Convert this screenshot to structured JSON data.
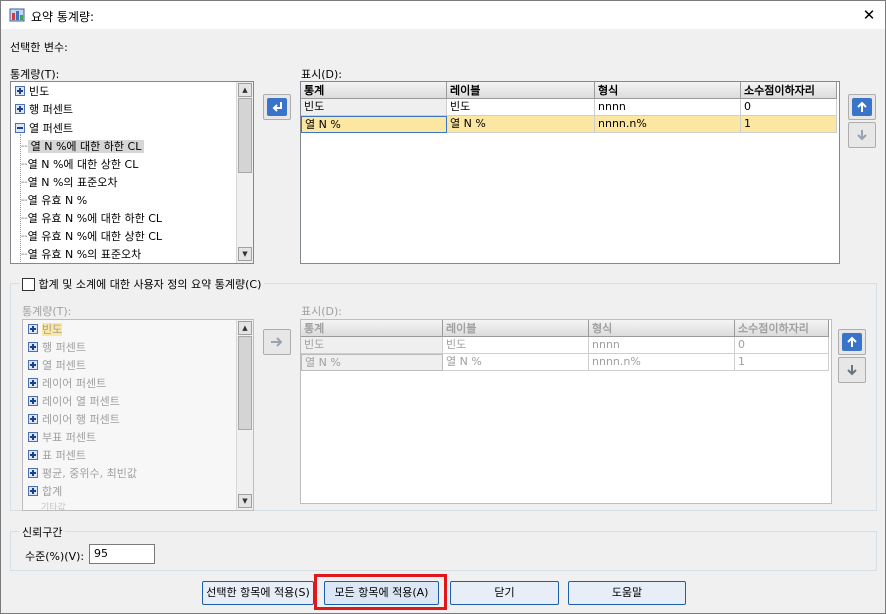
{
  "window": {
    "title": "요약 통계량:",
    "close_icon": "close-icon"
  },
  "selected_vars_label": "선택한 변수:",
  "stats_panel": {
    "label": "통계량(T):",
    "items": [
      {
        "label": "빈도",
        "expander": "plus"
      },
      {
        "label": "행 퍼센트",
        "expander": "plus"
      },
      {
        "label": "열 퍼센트",
        "expander": "minus"
      },
      {
        "label": "열 N %에 대한 하한 CL",
        "child": true,
        "selected": true
      },
      {
        "label": "열 N %에 대한 상한 CL",
        "child": true
      },
      {
        "label": "열 N %의 표준오차",
        "child": true
      },
      {
        "label": "열 유효 N %",
        "child": true
      },
      {
        "label": "열 유효 N %에 대한 하한 CL",
        "child": true
      },
      {
        "label": "열 유효 N %에 대한 상한 CL",
        "child": true
      },
      {
        "label": "열 유효 N %의 표준오차",
        "child": true
      }
    ]
  },
  "display_panel": {
    "label": "표시(D):",
    "columns": [
      "통계",
      "레이블",
      "형식",
      "소수점이하자리"
    ],
    "rows": [
      [
        "빈도",
        "빈도",
        "nnnn",
        "0"
      ],
      [
        "열 N %",
        "열 N %",
        "nnnn.n%",
        "1"
      ]
    ],
    "selected_row": 1
  },
  "custom_checkbox": {
    "label": "합계 및 소계에 대한 사용자 정의 요약 통계량(C)",
    "checked": false
  },
  "stats_panel2": {
    "label": "통계량(T):",
    "items": [
      "빈도",
      "행 퍼센트",
      "열 퍼센트",
      "레이어 퍼센트",
      "레이어 열 퍼센트",
      "레이어 행 퍼센트",
      "부표 퍼센트",
      "표 퍼센트",
      "평균, 중위수, 최빈값",
      "합계",
      "기타값"
    ]
  },
  "display_panel2": {
    "label": "표시(D):",
    "columns": [
      "통계",
      "레이블",
      "형식",
      "소수점이하자리"
    ],
    "rows": [
      [
        "빈도",
        "빈도",
        "nnnn",
        "0"
      ],
      [
        "열 N %",
        "열 N %",
        "nnnn.n%",
        "1"
      ]
    ]
  },
  "confidence": {
    "group_label": "신뢰구간",
    "level_label": "수준(%)(V):",
    "level_value": "95"
  },
  "buttons": {
    "apply_selected": "선택한 항목에 적용(S)",
    "apply_all": "모든 항목에 적용(A)",
    "close": "닫기",
    "help": "도움말"
  },
  "colors": {
    "selection": "#fbe7a1",
    "highlight": "#e0181b",
    "accent": "#3a74c8"
  }
}
